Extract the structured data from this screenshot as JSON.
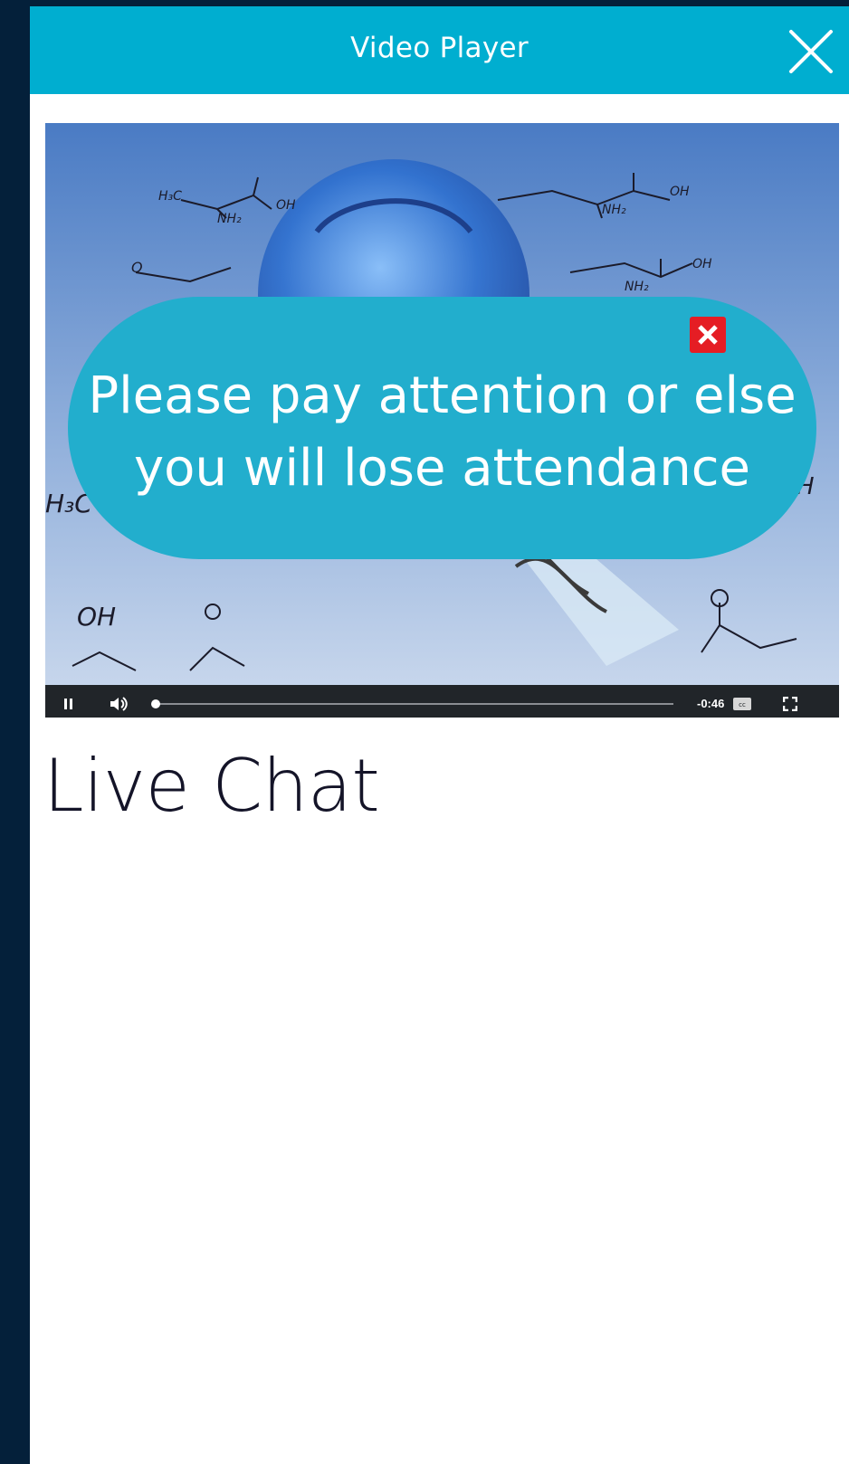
{
  "window": {
    "title": "Video Player"
  },
  "video": {
    "remaining_time": "-0:46",
    "progress": 0.0,
    "state": "playing",
    "controls": {
      "pause_icon": "pause-icon",
      "volume_icon": "volume-icon",
      "captions_icon": "captions-icon",
      "fullscreen_icon": "fullscreen-icon"
    }
  },
  "notice": {
    "line1": "Please pay attention or else",
    "line2": "you will lose attendance",
    "close_icon": "close-icon"
  },
  "chat": {
    "heading": "Live Chat"
  },
  "colors": {
    "accent": "#00aed0",
    "notice_bg": "#22aecd",
    "notice_close": "#e51d24",
    "sidebar": "#04203a"
  }
}
